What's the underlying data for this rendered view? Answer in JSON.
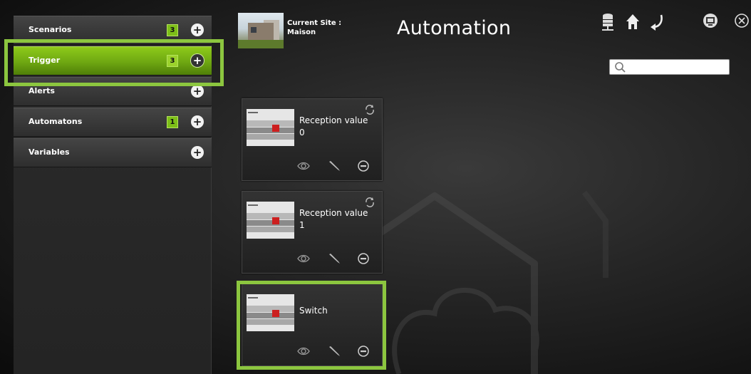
{
  "header": {
    "site_label": "Current Site :",
    "site_name": "Maison",
    "title": "Automation"
  },
  "toolbar": {
    "icons": [
      "database-icon",
      "home-icon",
      "back-arrow-icon",
      "monitor-icon",
      "close-icon"
    ]
  },
  "search": {
    "value": "",
    "placeholder": ""
  },
  "sidebar": {
    "items": [
      {
        "label": "Scenarios",
        "count": "3",
        "active": false
      },
      {
        "label": "Trigger",
        "count": "3",
        "active": true
      },
      {
        "label": "Alerts",
        "count": "",
        "active": false
      },
      {
        "label": "Automatons",
        "count": "1",
        "active": false
      },
      {
        "label": "Variables",
        "count": "",
        "active": false
      }
    ]
  },
  "cards": [
    {
      "title": "Reception value",
      "value": "0",
      "has_refresh": true
    },
    {
      "title": "Reception value",
      "value": "1",
      "has_refresh": true
    },
    {
      "title": "Switch",
      "value": "",
      "has_refresh": false
    }
  ],
  "card_actions": [
    "view-eye-icon",
    "edit-pencil-icon",
    "remove-minus-icon"
  ],
  "colors": {
    "accent": "#8cc63f",
    "active_item": "#7cba14",
    "background": "#1a1a1a",
    "badge": "#7dbf18"
  }
}
